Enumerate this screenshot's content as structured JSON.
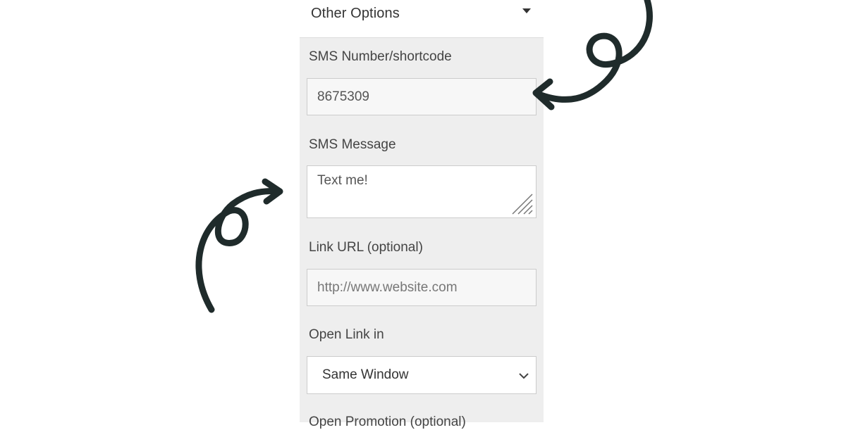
{
  "header": {
    "title": "Other Options",
    "caret_icon": "caret-down-icon"
  },
  "fields": {
    "sms_number": {
      "label": "SMS Number/shortcode",
      "value": "8675309"
    },
    "sms_message": {
      "label": "SMS Message",
      "value": "Text me!"
    },
    "link_url": {
      "label": "Link URL (optional)",
      "placeholder": "http://www.website.com"
    },
    "open_link": {
      "label": "Open Link in",
      "selected": "Same Window"
    },
    "open_promotion": {
      "label": "Open Promotion (optional)"
    }
  },
  "colors": {
    "panel_bg": "#eeeeee",
    "arrow": "#1f2b2b"
  }
}
